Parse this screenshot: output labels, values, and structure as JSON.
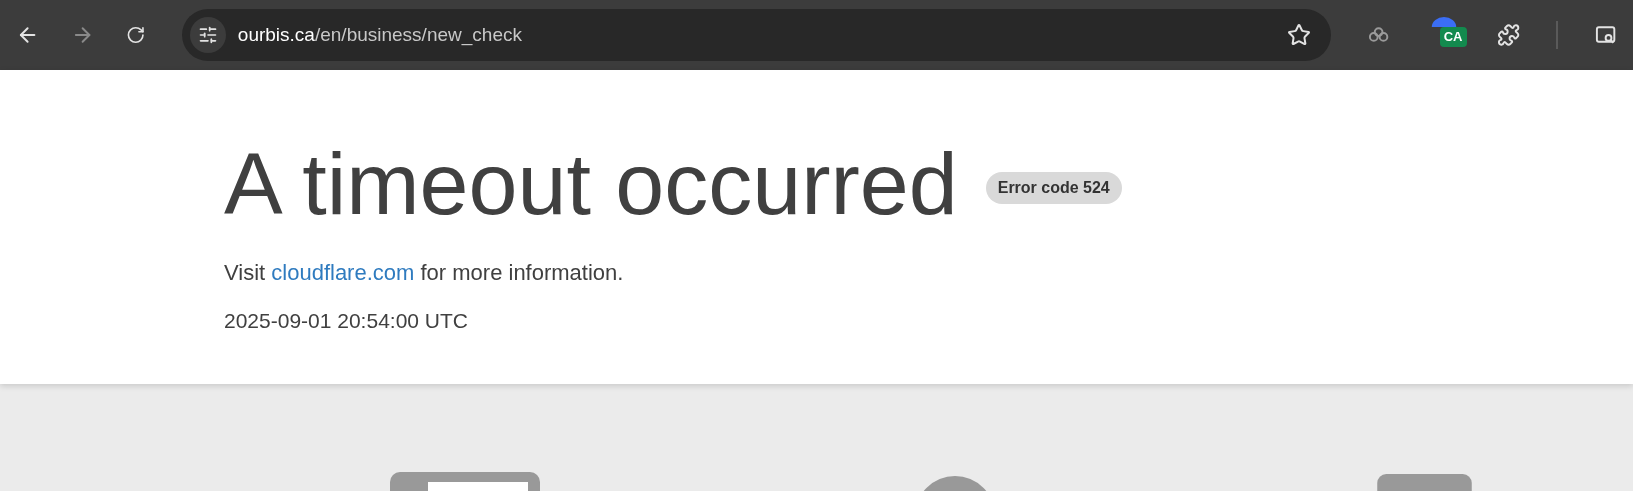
{
  "browser": {
    "url_host": "ourbis.ca",
    "url_path": "/en/business/new_check",
    "extension_badge": "CA"
  },
  "page": {
    "title": "A timeout occurred",
    "error_badge": "Error code 524",
    "info_prefix": "Visit ",
    "info_link": "cloudflare.com",
    "info_suffix": " for more information.",
    "timestamp": "2025-09-01 20:54:00 UTC"
  }
}
